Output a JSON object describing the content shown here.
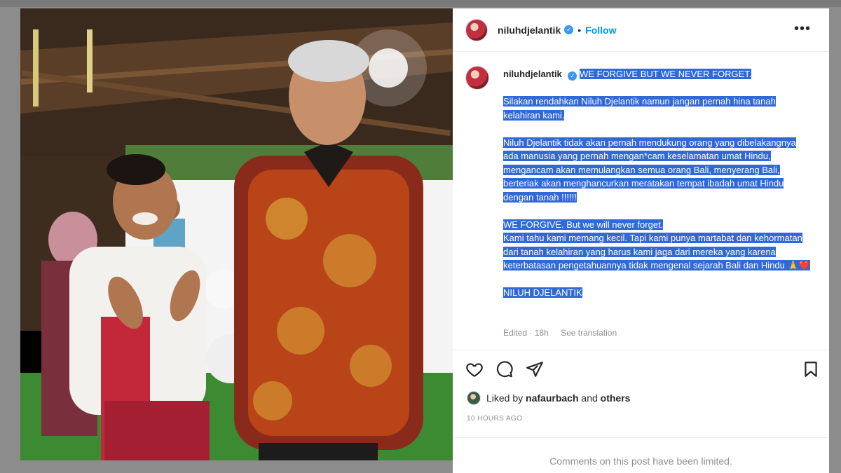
{
  "post": {
    "username": "niluhdjelantik",
    "follow_label": "Follow",
    "separator": "•",
    "more_label": "•••",
    "verified_mark": "✓",
    "caption": {
      "line1": "WE FORGIVE BUT WE NEVER FORGET.",
      "para1": "Silakan rendahkan Niluh Djelantik namun jangan pernah hina tanah kelahiran kami.",
      "para2": "Niluh Djelantik tidak akan pernah mendukung orang yang dibelakangnya ada manusia yang pernah mengan*cam keselamatan umat Hindu, mengancam akan memulangkan semua orang Bali, menyerang Bali, berteriak akan menghancurkan meratakan tempat ibadah umat Hindu dengan tanah !!!!!!",
      "para3a": "WE FORGIVE. But we will never forget.",
      "para3b": "Kami tahu kami memang kecil. Tapi kami punya martabat dan kehormatan dari tanah kelahiran yang harus kami jaga dari mereka yang karena keterbatasan pengetahuannya tidak mengenal sejarah Bali dan Hindu 🙏❤️",
      "signature": "NILUH DJELANTIK"
    },
    "edited_label": "Edited · 18h",
    "see_translation": "See translation",
    "liked_by_prefix": "Liked by",
    "liked_by_user": "nafaurbach",
    "liked_by_and": "and",
    "liked_by_others": "others",
    "time_ago": "10 HOURS AGO",
    "comments_limited": "Comments on this post have been limited."
  },
  "icons": {
    "verified": "verified-badge-icon",
    "like": "heart-icon",
    "comment": "comment-bubble-icon",
    "share": "paper-plane-icon",
    "save": "bookmark-icon",
    "more": "ellipsis-icon"
  },
  "colors": {
    "highlight": "#3169d8",
    "follow": "#0095f6",
    "verified": "#3897f0"
  }
}
